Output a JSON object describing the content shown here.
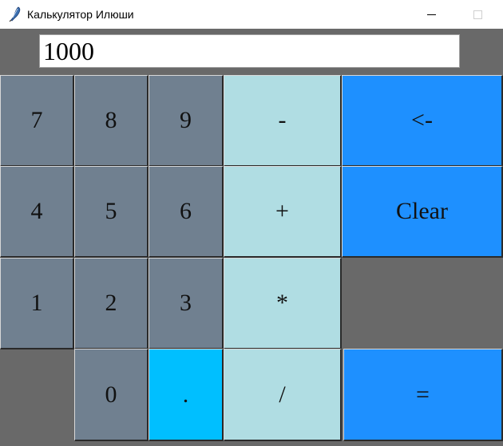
{
  "window": {
    "title": "Калькулятор Илюши"
  },
  "display": {
    "value": "1000"
  },
  "keys": {
    "k7": "7",
    "k8": "8",
    "k9": "9",
    "minus": "-",
    "backspace": "<-",
    "k4": "4",
    "k5": "5",
    "k6": "6",
    "plus": "+",
    "clear": "Clear",
    "k1": "1",
    "k2": "2",
    "k3": "3",
    "multiply": "*",
    "k0": "0",
    "dot": ".",
    "divide": "/",
    "equals": "="
  },
  "colors": {
    "background": "#696969",
    "digit_key": "#708090",
    "operator_key": "#b0dde3",
    "action_key": "#1e90ff",
    "dot_key": "#00bfff"
  }
}
